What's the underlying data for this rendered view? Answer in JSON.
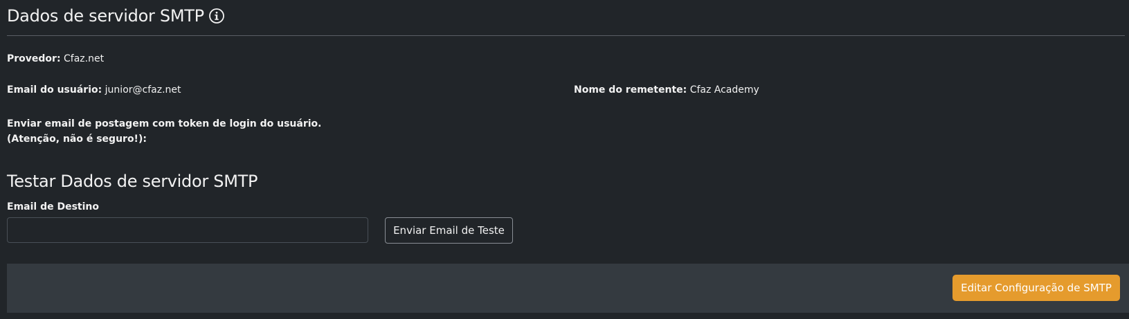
{
  "header": {
    "title": "Dados de servidor SMTP",
    "info_icon": "info-circle-icon"
  },
  "fields": {
    "provider": {
      "label": "Provedor:",
      "value": "Cfaz.net"
    },
    "user_email": {
      "label": "Email do usuário:",
      "value": "junior@cfaz.net"
    },
    "sender_name": {
      "label": "Nome do remetente:",
      "value": "Cfaz Academy"
    },
    "send_token_email": {
      "label": "Enviar email de postagem com token de login do usuário. (Atenção, não é seguro!):",
      "value": ""
    }
  },
  "test_section": {
    "title": "Testar Dados de servidor SMTP",
    "destination_label": "Email de Destino",
    "destination_value": "",
    "destination_placeholder": "",
    "send_button_label": "Enviar Email de Teste"
  },
  "footer": {
    "edit_button_label": "Editar Configuração de SMTP"
  },
  "colors": {
    "background": "#212529",
    "footer_background": "#343a40",
    "accent": "#e59b2d",
    "text": "#f2f2f2"
  }
}
